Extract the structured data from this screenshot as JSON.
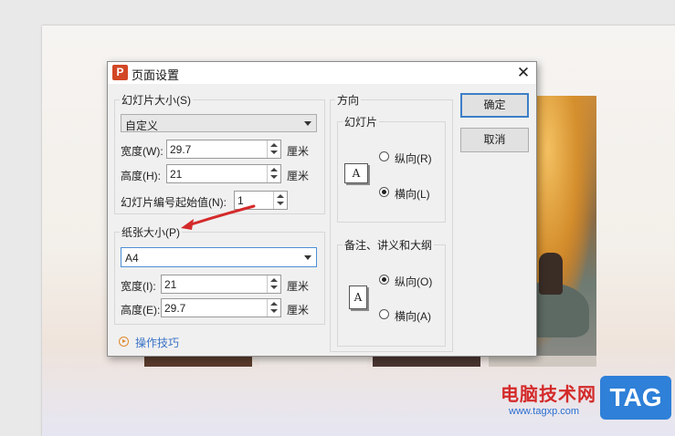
{
  "dialog": {
    "title": "页面设置",
    "app_icon_letter": "P",
    "close_glyph": "✕"
  },
  "slide_size": {
    "group_label": "幻灯片大小(S)",
    "selected": "自定义",
    "width_label": "宽度(W):",
    "width_value": "29.7",
    "height_label": "高度(H):",
    "height_value": "21",
    "unit": "厘米",
    "start_number_label": "幻灯片编号起始值(N):",
    "start_number_value": "1"
  },
  "paper_size": {
    "group_label": "纸张大小(P)",
    "selected": "A4",
    "width_label": "宽度(I):",
    "width_value": "21",
    "height_label": "高度(E):",
    "height_value": "29.7",
    "unit": "厘米"
  },
  "orientation": {
    "group_label": "方向",
    "slides": {
      "label": "幻灯片",
      "portrait": "纵向(R)",
      "landscape": "横向(L)",
      "selected": "landscape"
    },
    "notes": {
      "label": "备注、讲义和大纲",
      "portrait": "纵向(O)",
      "landscape": "横向(A)",
      "selected": "portrait"
    },
    "preview_letter": "A"
  },
  "buttons": {
    "ok": "确定",
    "cancel": "取消"
  },
  "tips_link": "操作技巧",
  "watermark": {
    "site_name": "电脑技术网",
    "url": "www.tagxp.com",
    "tag": "TAG"
  },
  "colors": {
    "accent": "#3c7fc7",
    "app_icon": "#d24726",
    "annotation_arrow": "#d42a2a",
    "link": "#3973c6"
  },
  "icons": [
    "app-icon",
    "close-icon",
    "spin-up-icon",
    "spin-down-icon",
    "dropdown-arrow-icon",
    "orientation-preview-icon",
    "play-circle-icon",
    "red-arrow-annotation"
  ]
}
